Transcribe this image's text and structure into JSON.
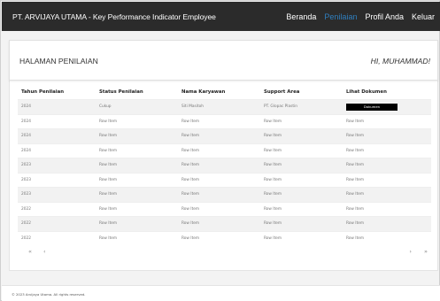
{
  "navbar": {
    "brand": "PT. ARVIJAYA UTAMA - Key Performance Indicator Employee",
    "links": [
      {
        "label": "Beranda",
        "active": false
      },
      {
        "label": "Penilaian",
        "active": true
      },
      {
        "label": "Profil Anda",
        "active": false
      },
      {
        "label": "Keluar",
        "active": false
      }
    ],
    "active_color": "#2f7fbf"
  },
  "header": {
    "title": "HALAMAN PENILAIAN",
    "greeting": "HI, MUHAMMAD!"
  },
  "table": {
    "columns": [
      "Tahun Penilaian",
      "Status Penilaian",
      "Nama Karyawan",
      "Support Area",
      "Lihat Dokumen"
    ],
    "rows": [
      [
        "2024",
        "Cukup",
        "Siti Masitoh",
        "PT. Glopac Plastin",
        "Dokumen"
      ],
      [
        "2024",
        "Row Item",
        "Row Item",
        "Row Item",
        "Row Item"
      ],
      [
        "2024",
        "Row Item",
        "Row Item",
        "Row Item",
        "Row Item"
      ],
      [
        "2024",
        "Row Item",
        "Row Item",
        "Row Item",
        "Row Item"
      ],
      [
        "2023",
        "Row Item",
        "Row Item",
        "Row Item",
        "Row Item"
      ],
      [
        "2023",
        "Row Item",
        "Row Item",
        "Row Item",
        "Row Item"
      ],
      [
        "2023",
        "Row Item",
        "Row Item",
        "Row Item",
        "Row Item"
      ],
      [
        "2022",
        "Row Item",
        "Row Item",
        "Row Item",
        "Row Item"
      ],
      [
        "2022",
        "Row Item",
        "Row Item",
        "Row Item",
        "Row Item"
      ],
      [
        "2022",
        "Row Item",
        "Row Item",
        "Row Item",
        "Row Item"
      ]
    ]
  },
  "pagination": {
    "first": "«",
    "prev": "‹",
    "next": "›",
    "last": "»"
  },
  "footer": {
    "text": "© 2023 Arvijaya Utama. All rights reserved."
  }
}
